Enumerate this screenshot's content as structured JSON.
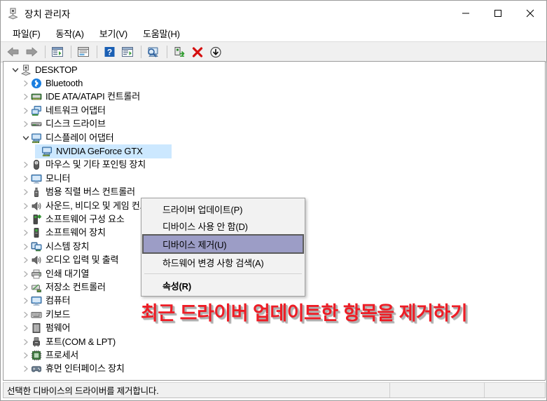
{
  "window": {
    "title": "장치 관리자",
    "title_icon": "device-manager-icon",
    "controls": {
      "minimize": "minimize-icon",
      "maximize": "maximize-icon",
      "close": "close-icon"
    }
  },
  "menubar": {
    "items": [
      {
        "label": "파일(F)",
        "name": "menu-file"
      },
      {
        "label": "동작(A)",
        "name": "menu-action"
      },
      {
        "label": "보기(V)",
        "name": "menu-view"
      },
      {
        "label": "도움말(H)",
        "name": "menu-help"
      }
    ]
  },
  "toolbar": {
    "buttons": [
      {
        "icon": "back-arrow-icon"
      },
      {
        "icon": "forward-arrow-icon"
      },
      {
        "icon": "separator"
      },
      {
        "icon": "properties-icon"
      },
      {
        "icon": "separator"
      },
      {
        "icon": "help-window-icon"
      },
      {
        "icon": "separator"
      },
      {
        "icon": "help-question-icon"
      },
      {
        "icon": "update-driver-icon"
      },
      {
        "icon": "separator"
      },
      {
        "icon": "scan-hardware-icon"
      },
      {
        "icon": "separator"
      },
      {
        "icon": "enable-device-icon"
      },
      {
        "icon": "uninstall-device-icon"
      },
      {
        "icon": "disable-device-icon"
      }
    ]
  },
  "tree": {
    "root": {
      "label": "DESKTOP",
      "icon": "computer-root-icon",
      "expanded": true,
      "depth": 0
    },
    "items": [
      {
        "label": "Bluetooth",
        "icon": "bluetooth-icon",
        "depth": 1,
        "expanded": false
      },
      {
        "label": "IDE ATA/ATAPI 컨트롤러",
        "icon": "ide-controller-icon",
        "depth": 1,
        "expanded": false
      },
      {
        "label": "네트워크 어댑터",
        "icon": "network-adapter-icon",
        "depth": 1,
        "expanded": false
      },
      {
        "label": "디스크 드라이브",
        "icon": "disk-drive-icon",
        "depth": 1,
        "expanded": false
      },
      {
        "label": "디스플레이 어댑터",
        "icon": "display-adapter-icon",
        "depth": 1,
        "expanded": true
      },
      {
        "label": "NVIDIA GeForce GTX",
        "icon": "display-adapter-icon",
        "depth": 2,
        "expanded": null,
        "selected": true
      },
      {
        "label": "마우스 및 기타 포인팅 장치",
        "icon": "mouse-icon",
        "depth": 1,
        "expanded": false
      },
      {
        "label": "모니터",
        "icon": "monitor-icon",
        "depth": 1,
        "expanded": false
      },
      {
        "label": "범용 직렬 버스 컨트롤러",
        "icon": "usb-controller-icon",
        "depth": 1,
        "expanded": false
      },
      {
        "label": "사운드, 비디오 및 게임 컨트롤러",
        "icon": "sound-icon",
        "depth": 1,
        "expanded": false
      },
      {
        "label": "소프트웨어 구성 요소",
        "icon": "software-component-icon",
        "depth": 1,
        "expanded": false
      },
      {
        "label": "소프트웨어 장치",
        "icon": "software-device-icon",
        "depth": 1,
        "expanded": false
      },
      {
        "label": "시스템 장치",
        "icon": "system-device-icon",
        "depth": 1,
        "expanded": false
      },
      {
        "label": "오디오 입력 및 출력",
        "icon": "audio-io-icon",
        "depth": 1,
        "expanded": false
      },
      {
        "label": "인쇄 대기열",
        "icon": "print-queue-icon",
        "depth": 1,
        "expanded": false
      },
      {
        "label": "저장소 컨트롤러",
        "icon": "storage-controller-icon",
        "depth": 1,
        "expanded": false
      },
      {
        "label": "컴퓨터",
        "icon": "computer-icon",
        "depth": 1,
        "expanded": false
      },
      {
        "label": "키보드",
        "icon": "keyboard-icon",
        "depth": 1,
        "expanded": false
      },
      {
        "label": "펌웨어",
        "icon": "firmware-icon",
        "depth": 1,
        "expanded": false
      },
      {
        "label": "포트(COM & LPT)",
        "icon": "port-icon",
        "depth": 1,
        "expanded": false
      },
      {
        "label": "프로세서",
        "icon": "processor-icon",
        "depth": 1,
        "expanded": false
      },
      {
        "label": "휴먼 인터페이스 장치",
        "icon": "hid-icon",
        "depth": 1,
        "expanded": false
      }
    ]
  },
  "context_menu": {
    "items": [
      {
        "label": "드라이버 업데이트(P)",
        "name": "ctx-update-driver",
        "highlighted": false,
        "bold": false
      },
      {
        "label": "디바이스 사용 안 함(D)",
        "name": "ctx-disable-device",
        "highlighted": false,
        "bold": false
      },
      {
        "label": "디바이스 제거(U)",
        "name": "ctx-uninstall-device",
        "highlighted": true,
        "bold": false
      },
      {
        "label": "하드웨어 변경 사항 검색(A)",
        "name": "ctx-scan-hardware",
        "highlighted": false,
        "bold": false
      },
      {
        "label": "속성(R)",
        "name": "ctx-properties",
        "highlighted": false,
        "bold": true
      }
    ]
  },
  "annotation": {
    "text": "최근 드라이버 업데이트한 항목을 제거하기",
    "color": "#ee1c25"
  },
  "statusbar": {
    "text": "선택한 디바이스의 드라이버를 제거합니다."
  },
  "colors": {
    "selection": "#cce8ff",
    "menu_highlight": "#9c9dc6",
    "menu_highlight_border": "#5a5a5a",
    "toolbar_bg": "#f0f0f0",
    "statusbar_bg": "#f0f0f0"
  }
}
